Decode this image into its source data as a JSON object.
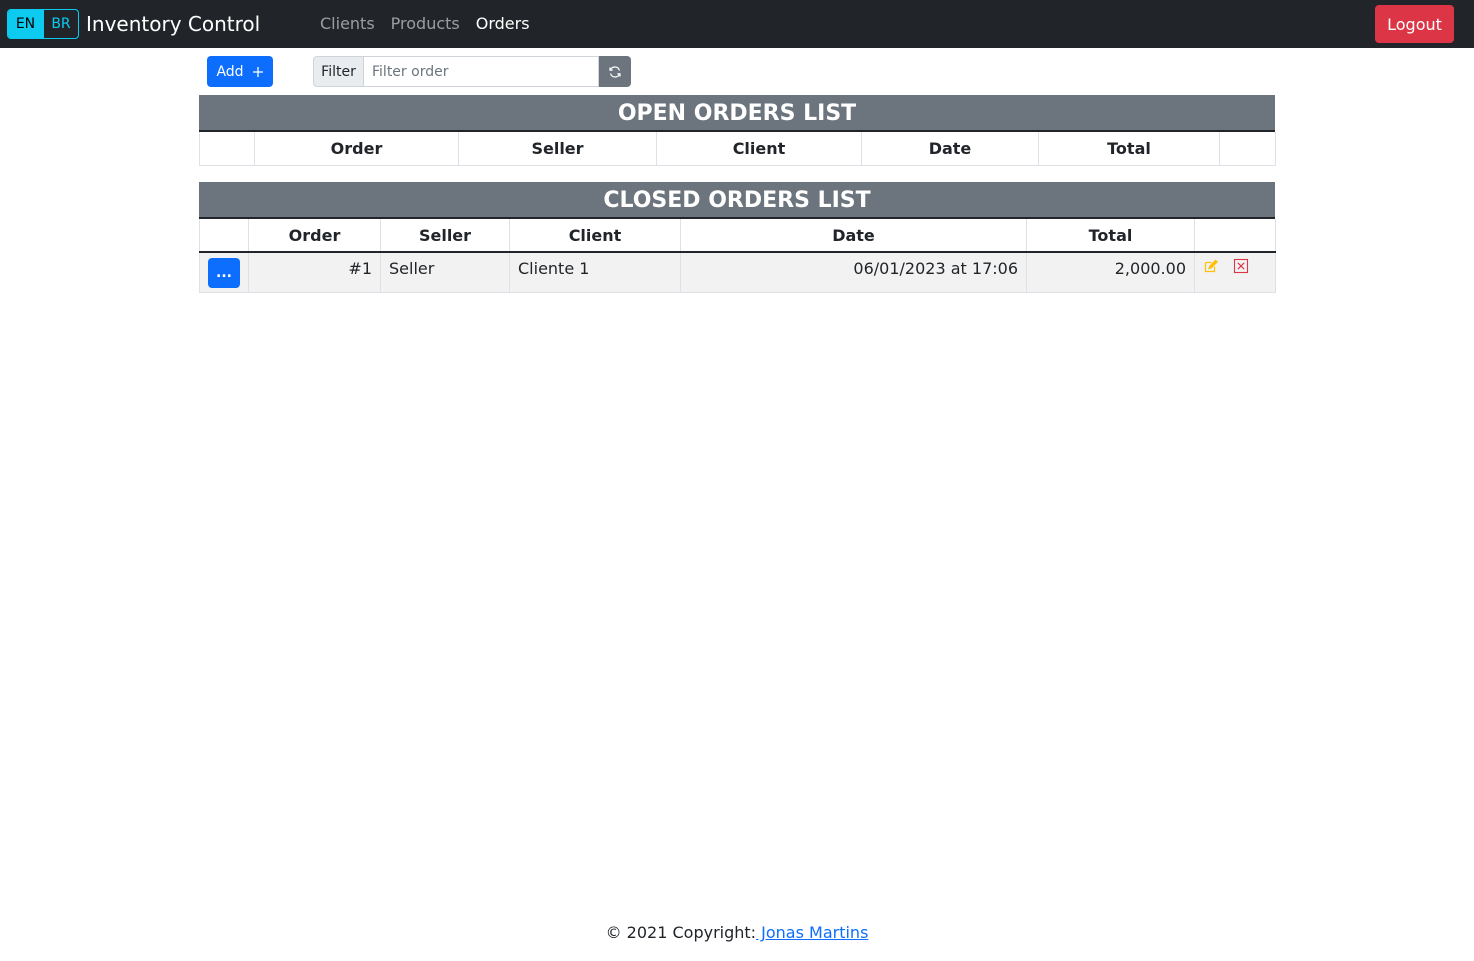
{
  "navbar": {
    "lang_en": "EN",
    "lang_br": "BR",
    "brand": "Inventory Control",
    "links": [
      {
        "label": "Clients"
      },
      {
        "label": "Products"
      },
      {
        "label": "Orders"
      }
    ],
    "active_link": "Orders",
    "logout_label": "Logout"
  },
  "toolbar": {
    "add_label": "Add",
    "filter_label": "Filter",
    "filter_placeholder": "Filter order",
    "filter_value": ""
  },
  "open_orders": {
    "title": "OPEN ORDERS LIST",
    "headers": [
      "",
      "Order",
      "Seller",
      "Client",
      "Date",
      "Total",
      ""
    ],
    "rows": []
  },
  "closed_orders": {
    "title": "CLOSED ORDERS LIST",
    "headers": [
      "",
      "Order",
      "Seller",
      "Client",
      "Date",
      "Total",
      ""
    ],
    "rows": [
      {
        "more_label": "...",
        "order": "#1",
        "seller": "Seller",
        "client": "Cliente 1",
        "date": "06/01/2023 at 17:06",
        "total": "2,000.00"
      }
    ]
  },
  "footer": {
    "text": "© 2021 Copyright:",
    "link_text": " Jonas Martins"
  },
  "colors": {
    "navbar_bg": "#212529",
    "info": "#0dcaf0",
    "primary": "#0d6efd",
    "danger": "#dc3545",
    "secondary": "#6c757d",
    "warning": "#ffc107"
  },
  "icons": {
    "add": "plus-icon",
    "refresh": "refresh-icon",
    "edit": "edit-icon",
    "delete": "delete-icon"
  }
}
